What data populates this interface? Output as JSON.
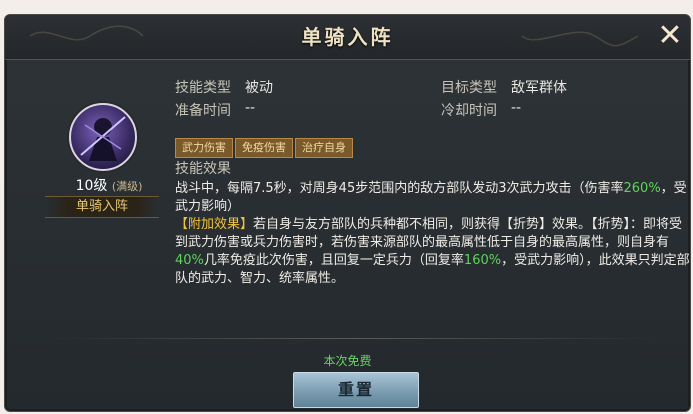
{
  "window": {
    "title": "单骑入阵"
  },
  "skill": {
    "level": "10级",
    "level_max": "(满级)",
    "name_tag": "单骑入阵",
    "type_label": "技能类型",
    "type_value": "被动",
    "prep_label": "准备时间",
    "prep_value": "--",
    "target_label": "目标类型",
    "target_value": "敌军群体",
    "cooldown_label": "冷却时间",
    "cooldown_value": "--",
    "tags": [
      "武力伤害",
      "免疫伤害",
      "治疗自身"
    ],
    "effect_label": "技能效果",
    "effect": {
      "p1a": "战斗中，每隔7.5秒，对周身45步范围内的敌方部队发动3次武力攻击（伤害率",
      "p1g": "260%",
      "p1b": "，受武力影响）",
      "p2g": "【附加效果】",
      "p2a": "若自身与友方部队的兵种都不相同，则获得【折势】效果。【折势】：即将受到武力伤害或兵力伤害时，若伤害来源部队的最高属性低于自身的最高属性，则自身有",
      "p2p": "40%",
      "p2b": "几率免疫此次伤害，且回复一定兵力（回复率",
      "p2q": "160%",
      "p2c": "，受武力影响），此效果只判定部队的武力、智力、统率属性。"
    }
  },
  "footer": {
    "free_text": "本次免费",
    "reset_label": "重置"
  },
  "colors": {
    "green": "#5fd35b",
    "gold": "#f1c33b"
  }
}
